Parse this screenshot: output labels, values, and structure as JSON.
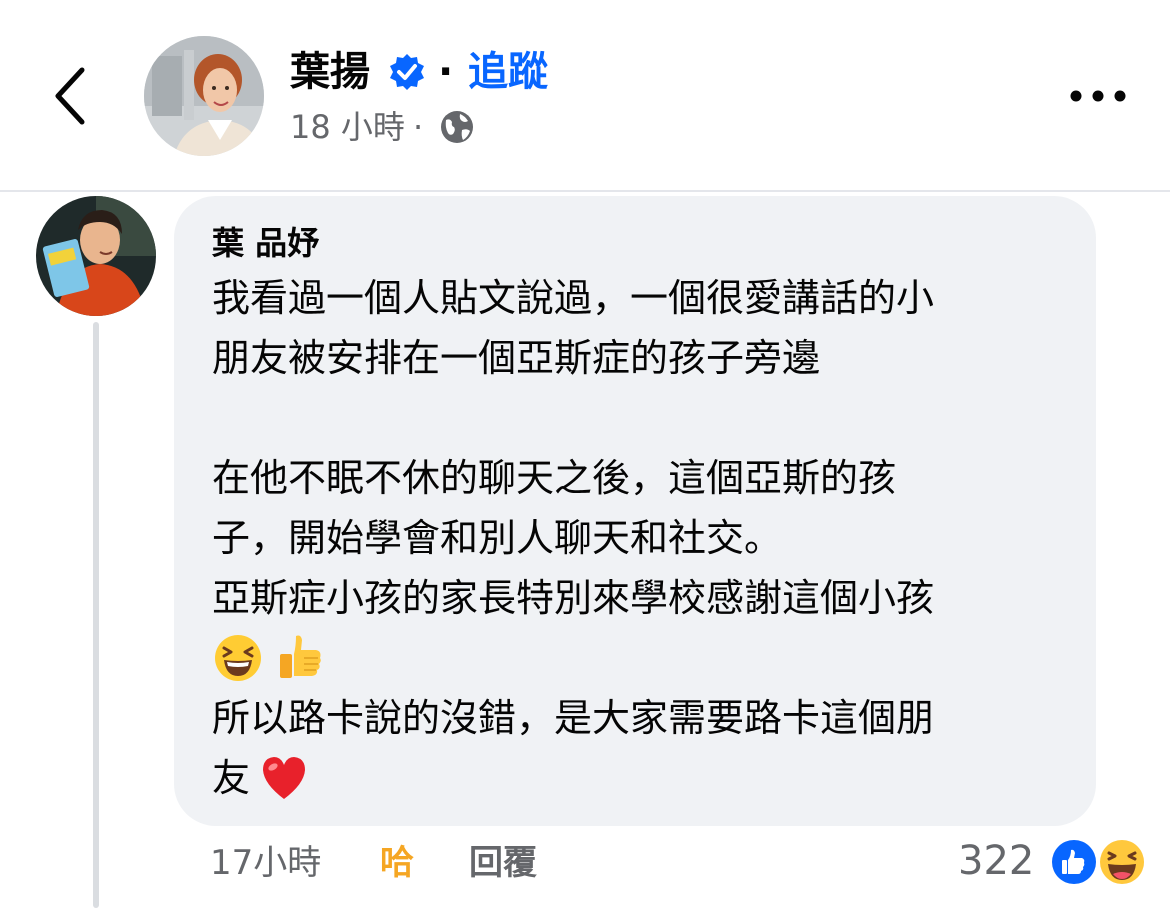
{
  "post_header": {
    "author_name": "葉揚",
    "separator": "·",
    "follow_label": "追蹤",
    "timestamp": "18 小時",
    "time_separator": "·",
    "icons": {
      "back": "chevron-left-icon",
      "verified": "verified-badge-icon",
      "privacy": "globe-icon",
      "more": "more-horizontal-icon"
    },
    "accent_color": "#0866ff"
  },
  "comment": {
    "author_name": "葉 品妤",
    "lines": [
      "我看過一個人貼文說過，一個很愛講話的小",
      "朋友被安排在一個亞斯症的孩子旁邊",
      "在他不眠不休的聊天之後，這個亞斯的孩",
      "子，開始學會和別人聊天和社交。",
      "亞斯症小孩的家長特別來學校感謝這個小孩",
      "所以路卡說的沒錯，是大家需要路卡這個朋",
      "友"
    ],
    "emojis": [
      "laughing-face-emoji",
      "thumbs-up-emoji",
      "red-heart-emoji"
    ],
    "footer": {
      "time": "17小時",
      "reaction_label": "哈",
      "reply_label": "回覆",
      "reaction_count": "322",
      "reaction_icons": [
        "like-icon",
        "haha-icon"
      ]
    },
    "bubble_color": "#f0f2f5",
    "reaction_label_color": "#f5a623"
  }
}
